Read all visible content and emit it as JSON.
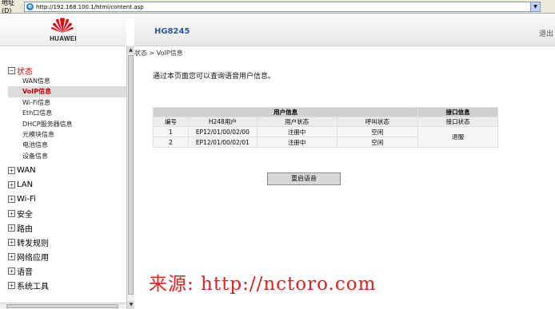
{
  "address_bar": {
    "label": "地址(D)",
    "url": "http://192.168.100.1/html/content.asp"
  },
  "logo": {
    "text": "HUAWEI",
    "brand_color": "#e60012"
  },
  "header": {
    "model": "HG8245",
    "logout": "退出"
  },
  "menu": {
    "status": {
      "label": "状态",
      "items": [
        "WAN信息",
        "VoIP信息",
        "Wi-Fi信息",
        "Eth口信息",
        "DHCP服务器信息",
        "光模块信息",
        "电池信息",
        "设备信息"
      ],
      "active": "VoIP信息"
    },
    "groups": [
      "WAN",
      "LAN",
      "Wi-Fi",
      "安全",
      "路由",
      "转发规则",
      "网络应用",
      "语音",
      "系统工具"
    ]
  },
  "breadcrumb": "状态 > VoIP信息",
  "description": "通过本页面您可以查询语音用户信息。",
  "table": {
    "group_user": "用户信息",
    "group_port": "接口信息",
    "headers": [
      "编号",
      "H248用户",
      "用户状态",
      "呼叫状态",
      "接口状态"
    ],
    "rows": [
      {
        "id": "1",
        "user": "EP12/01/00/02/00",
        "user_status": "注册中",
        "call_status": "空闲"
      },
      {
        "id": "2",
        "user": "EP12/01/00/02/01",
        "user_status": "注册中",
        "call_status": "空闲"
      }
    ],
    "port_status": "退服"
  },
  "restart_button": "重启语音",
  "watermark": "来源: http://nctoro.com"
}
